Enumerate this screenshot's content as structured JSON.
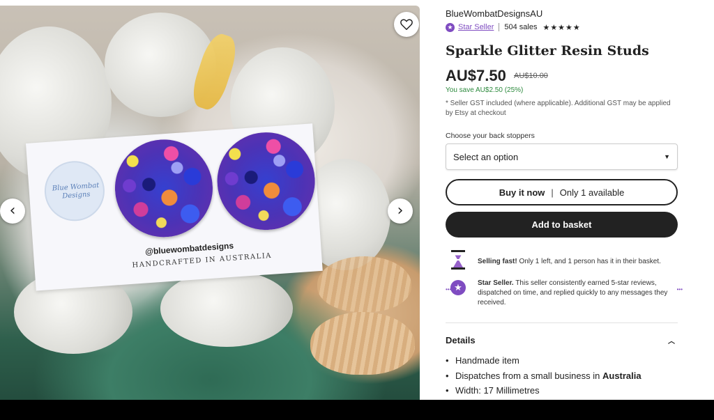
{
  "shop": {
    "name": "BlueWombatDesignsAU",
    "star_seller_label": "Star Seller",
    "sales": "504 sales",
    "stars": "★★★★★"
  },
  "product": {
    "title": "Sparkle Glitter Resin Studs",
    "price": "AU$7.50",
    "original_price": "AU$10.00",
    "savings": "You save AU$2.50 (25%)",
    "gst_note": "* Seller GST included (where applicable). Additional GST may be applied by Etsy at checkout"
  },
  "options": {
    "label": "Choose your back stoppers",
    "placeholder": "Select an option"
  },
  "actions": {
    "buy_now": "Buy it now",
    "availability": "Only 1 available",
    "add_to_basket": "Add to basket"
  },
  "highlights": {
    "selling_fast_title": "Selling fast!",
    "selling_fast_text": " Only 1 left, and 1 person has it in their basket.",
    "star_seller_title": "Star Seller.",
    "star_seller_text": " This seller consistently earned 5-star reviews, dispatched on time, and replied quickly to any messages they received."
  },
  "details": {
    "heading": "Details",
    "items": [
      {
        "text": "Handmade item",
        "bold": ""
      },
      {
        "text": "Dispatches from a small business in ",
        "bold": "Australia"
      },
      {
        "text": "Width: 17 Millimetres",
        "bold": ""
      }
    ]
  },
  "gallery": {
    "card_handle": "@bluewombatdesigns",
    "card_tagline": "HANDCRAFTED IN AUSTRALIA",
    "logo_text": "Blue Wombat Designs"
  },
  "colors": {
    "accent_purple": "#7f4cc1",
    "savings_green": "#2c8a3d",
    "button_dark": "#222222"
  },
  "icons": {
    "favorite": "heart-icon",
    "prev": "chevron-left-icon",
    "next": "chevron-right-icon",
    "dropdown": "caret-down-icon",
    "selling_fast": "hourglass-icon",
    "star_seller": "star-seller-badge-icon",
    "details_toggle": "chevron-up-icon"
  }
}
